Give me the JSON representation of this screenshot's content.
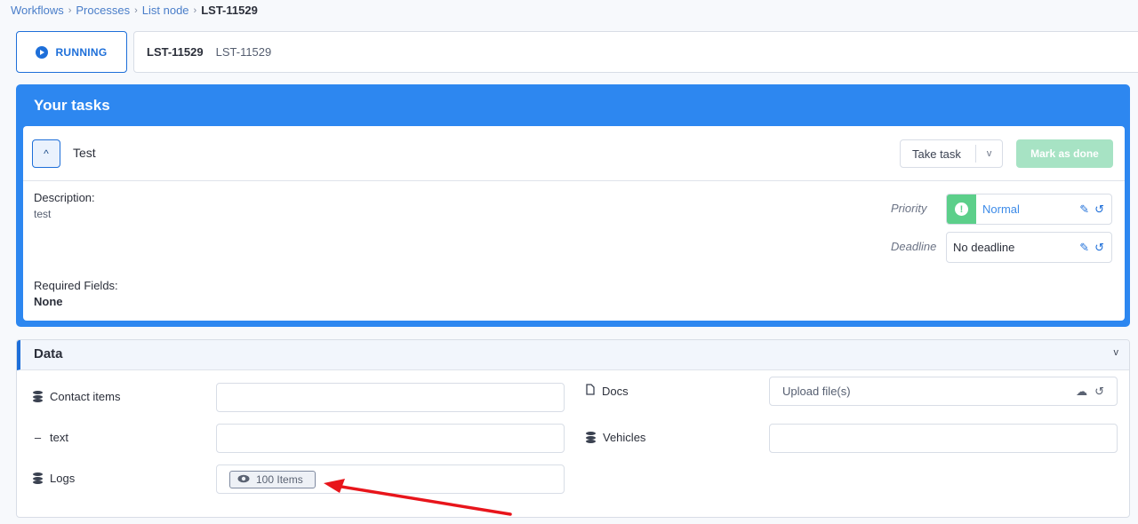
{
  "breadcrumb": {
    "items": [
      "Workflows",
      "Processes",
      "List node"
    ],
    "current": "LST-11529"
  },
  "status": {
    "label": "RUNNING"
  },
  "record": {
    "id": "LST-11529",
    "name": "LST-11529"
  },
  "tasks": {
    "title": "Your tasks",
    "task": {
      "name": "Test",
      "take_task_label": "Take task",
      "mark_done_label": "Mark as done",
      "description_label": "Description:",
      "description": "test",
      "required_fields_label": "Required Fields:",
      "required_fields": "None",
      "priority_label": "Priority",
      "priority": "Normal",
      "deadline_label": "Deadline",
      "deadline": "No deadline"
    }
  },
  "data": {
    "title": "Data",
    "fields": {
      "contact_items": "Contact items",
      "text": "text",
      "logs": "Logs",
      "logs_items": "100 Items",
      "docs": "Docs",
      "upload_placeholder": "Upload file(s)",
      "vehicles": "Vehicles"
    }
  },
  "colors": {
    "accent": "#1e6fd9",
    "panel_blue": "#2d87f0",
    "priority_green": "#5ccf8a",
    "done_disabled": "#a7e3c4",
    "annotation_arrow": "#e8151b"
  },
  "icons": [
    "play-icon",
    "chevron-up-icon",
    "chevron-down-icon",
    "exclamation-icon",
    "pencil-icon",
    "history-icon",
    "database-icon",
    "minus-icon",
    "file-icon",
    "cloud-upload-icon",
    "eye-icon",
    "arrow-annotation"
  ]
}
